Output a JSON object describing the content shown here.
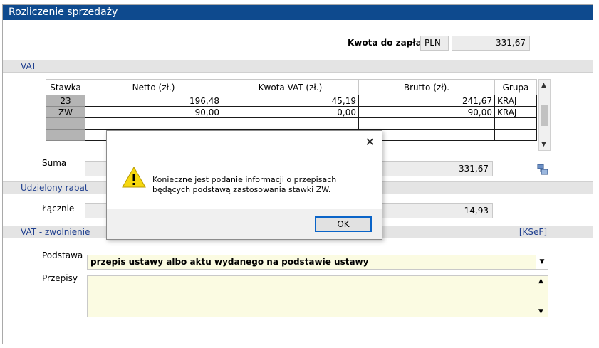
{
  "window": {
    "title": "Rozliczenie sprzedaży"
  },
  "payment": {
    "label": "Kwota do zapłaty",
    "currency": "PLN",
    "amount": "331,67"
  },
  "sections": {
    "vat": "VAT",
    "discount": "Udzielony rabat",
    "exemption": "VAT - zwolnienie",
    "ksef": "[KSeF]"
  },
  "vat_table": {
    "headers": [
      "Stawka",
      "Netto (zł.)",
      "Kwota VAT (zł.)",
      "Brutto (zł).",
      "Grupa"
    ],
    "rows": [
      [
        "23",
        "196,48",
        "45,19",
        "241,67",
        "KRAJ"
      ],
      [
        "ZW",
        "90,00",
        "0,00",
        "90,00",
        "KRAJ"
      ],
      [
        "",
        "",
        "",
        "",
        ""
      ],
      [
        "",
        "",
        "",
        "",
        ""
      ]
    ]
  },
  "summary": {
    "sum_label": "Suma",
    "sum_value": "331,67"
  },
  "discount": {
    "total_label": "Łącznie",
    "total_value": "14,93"
  },
  "exemption": {
    "basis_label": "Podstawa",
    "basis_value": "przepis ustawy albo aktu wydanego na podstawie ustawy",
    "rules_label": "Przepisy",
    "rules_value": ""
  },
  "dialog": {
    "message": "Konieczne jest podanie informacji o przepisach będących podstawą zastosowania stawki ZW.",
    "ok_label": "OK",
    "close_glyph": "✕"
  },
  "colors": {
    "titlebar": "#0e4a8e",
    "section_text": "#1f3f8f",
    "field_yellow": "#fbfbe2"
  }
}
